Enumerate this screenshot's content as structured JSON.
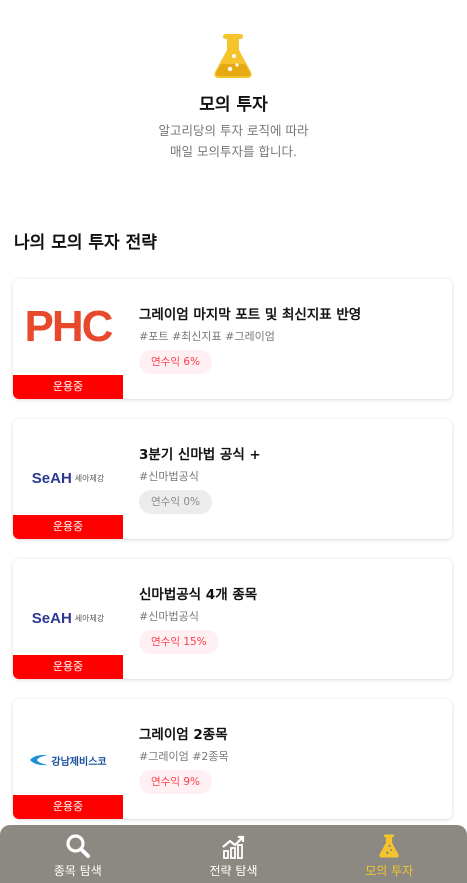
{
  "hero": {
    "title": "모의 투자",
    "desc_line1": "알고리당의 투자 로직에 따라",
    "desc_line2": "매일 모의투자를 합니다."
  },
  "section": {
    "title": "나의 모의 투자 전략"
  },
  "strategies": [
    {
      "title": "그레이엄 마지막 포트 및 최신지표 반영",
      "tags": "#포트 #최신지표 #그레이엄",
      "badge": "연수익 6%",
      "status": "운용중",
      "logo_text": "PHC",
      "logo_color": "#e8492d"
    },
    {
      "title": "3분기 신마법 공식 +",
      "tags": "#신마법공식",
      "badge": "연수익 0%",
      "status": "운용중",
      "logo_text": "SeAH",
      "logo_sub": "세아제강",
      "logo_color": "#2b3990"
    },
    {
      "title": "신마법공식 4개 종목",
      "tags": "#신마법공식",
      "badge": "연수익 15%",
      "status": "운용중",
      "logo_text": "SeAH",
      "logo_sub": "세아제강",
      "logo_color": "#2b3990"
    },
    {
      "title": "그레이엄 2종목",
      "tags": "#그레이엄 #2종목",
      "badge": "연수익 9%",
      "status": "운용중",
      "logo_text": "강남제비스코",
      "logo_color": "#1a4fa0"
    }
  ],
  "tabs": [
    {
      "label": "종목 탐색",
      "icon": "search-icon"
    },
    {
      "label": "전략 탐색",
      "icon": "chart-icon"
    },
    {
      "label": "모의 투자",
      "icon": "flask-icon",
      "active": true
    }
  ],
  "colors": {
    "accent": "#f5c42c",
    "status": "#ff0000",
    "tabbar": "#8c8882"
  }
}
